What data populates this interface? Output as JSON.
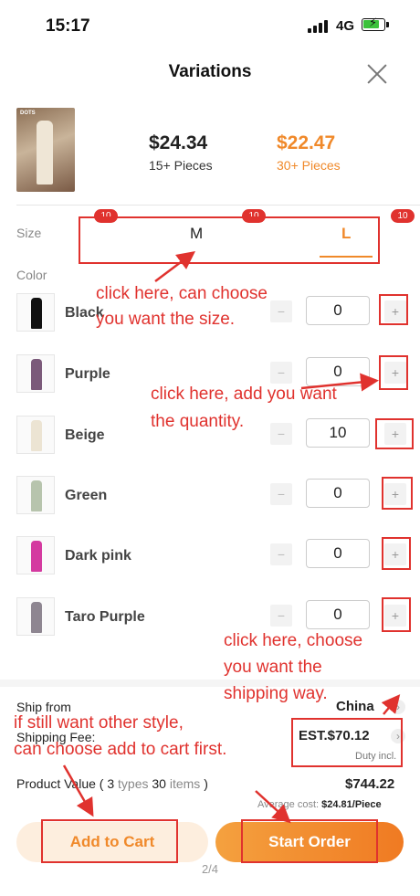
{
  "status_bar": {
    "time": "15:17",
    "network": "4G"
  },
  "header": {
    "title": "Variations"
  },
  "product": {
    "tiers": [
      {
        "price": "$24.34",
        "pieces": "15+ Pieces"
      },
      {
        "price": "$22.47",
        "pieces": "30+ Pieces"
      }
    ],
    "thumb_tag": "DOTS"
  },
  "size": {
    "label": "Size",
    "options": [
      {
        "label": "M",
        "badge": "10"
      },
      {
        "label": "L",
        "badge": "10"
      }
    ],
    "left_badge": "10",
    "selected": "L"
  },
  "color": {
    "label": "Color",
    "items": [
      {
        "name": "Black",
        "qty": "0",
        "minus": "−",
        "plus": "+"
      },
      {
        "name": "Purple",
        "qty": "0",
        "minus": "−",
        "plus": "+"
      },
      {
        "name": "Beige",
        "qty": "10",
        "minus": "−",
        "plus": "+"
      },
      {
        "name": "Green",
        "qty": "0",
        "minus": "−",
        "plus": "+"
      },
      {
        "name": "Dark pink",
        "qty": "0",
        "minus": "−",
        "plus": "+"
      },
      {
        "name": "Taro Purple",
        "qty": "0",
        "minus": "−",
        "plus": "+"
      }
    ]
  },
  "annotations": {
    "size_note_1": "click here, can choose",
    "size_note_2": "you want the size.",
    "qty_note_1": "click here, add you want",
    "qty_note_2": "the quantity.",
    "ship_note_1": "click here, choose",
    "ship_note_2": "you want the",
    "ship_note_3": "shipping way.",
    "cart_note_1": "if still want other style,",
    "cart_note_2": "can choose add to cart first."
  },
  "shipping": {
    "from_label": "Ship from",
    "from_value": "China",
    "fee_label": "Shipping Fee:",
    "fee_value": "EST.$70.12",
    "fee_note": "Duty incl."
  },
  "summary": {
    "label": "Product Value",
    "types_open": "( 3",
    "types_word": "types",
    "items_count": "30",
    "items_word": "items",
    "close_paren": ")",
    "value": "$744.22",
    "avg_label": "Average cost:",
    "avg_value": "$24.81/Piece"
  },
  "actions": {
    "add_to_cart": "Add to Cart",
    "start_order": "Start Order"
  },
  "pager": "2/4",
  "colors": {
    "accent": "#f0892a",
    "annotation": "#e0322e",
    "badge": "#e0322e"
  }
}
